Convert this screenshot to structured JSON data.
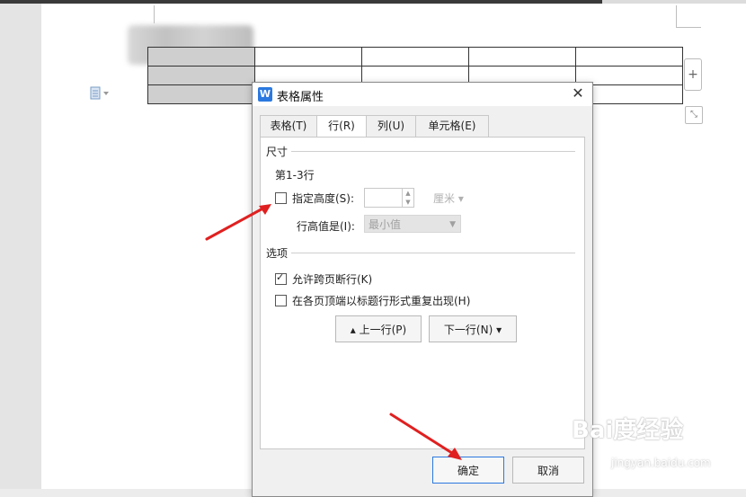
{
  "dialog": {
    "title": "表格属性",
    "close_glyph": "✕",
    "app_icon_glyph": "W",
    "tabs": [
      {
        "label": "表格(T)"
      },
      {
        "label": "行(R)"
      },
      {
        "label": "列(U)"
      },
      {
        "label": "单元格(E)"
      }
    ],
    "size_section": {
      "label": "尺寸",
      "rows_text": "第1-3行",
      "specify_height_label": "指定高度(S):",
      "specify_height_checked": false,
      "height_value": "",
      "unit": "厘米",
      "row_height_is_label": "行高值是(I):",
      "row_height_mode": "最小值"
    },
    "options_section": {
      "label": "选项",
      "allow_break_label": "允许跨页断行(K)",
      "allow_break_checked": true,
      "repeat_header_label": "在各页顶端以标题行形式重复出现(H)",
      "repeat_header_checked": false
    },
    "prev_row_label": "上一行(P)",
    "next_row_label": "下一行(N)",
    "ok_label": "确定",
    "cancel_label": "取消"
  },
  "document": {
    "add_column_glyph": "+",
    "paragraph_icon": "paragraph-mark-icon"
  },
  "watermark": {
    "brand": "Bai度经验",
    "site": "jingyan.baidu.com"
  },
  "colors": {
    "accent": "#2b79e0",
    "arrow": "#e02020"
  }
}
